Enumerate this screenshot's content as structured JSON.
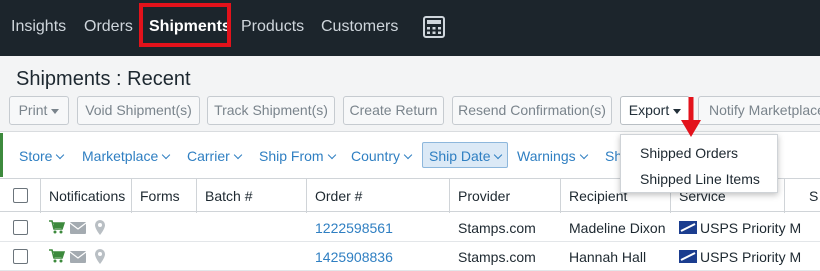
{
  "topnav": {
    "items": [
      {
        "label": "Insights"
      },
      {
        "label": "Orders"
      },
      {
        "label": "Shipments"
      },
      {
        "label": "Products"
      },
      {
        "label": "Customers"
      }
    ],
    "active": "Shipments",
    "icon": "calculator-icon",
    "highlight_color": "#e3121b"
  },
  "header": {
    "title": "Shipments : Recent",
    "buttons": {
      "print": "Print",
      "void": "Void Shipment(s)",
      "track": "Track Shipment(s)",
      "create_return": "Create Return",
      "resend": "Resend Confirmation(s)",
      "export": "Export",
      "notify": "Notify Marketplace"
    }
  },
  "filters": {
    "store": "Store",
    "marketplace": "Marketplace",
    "carrier": "Carrier",
    "ship_from": "Ship From",
    "country": "Country",
    "ship_date": "Ship Date",
    "warnings": "Warnings",
    "truncated": "Sh"
  },
  "export_menu": {
    "items": [
      "Shipped Orders",
      "Shipped Line Items"
    ]
  },
  "grid": {
    "columns": {
      "notifications": "Notifications",
      "forms": "Forms",
      "batch": "Batch #",
      "order": "Order #",
      "provider": "Provider",
      "recipient": "Recipient",
      "service": "Service",
      "last": "S"
    },
    "rows": [
      {
        "order": "1222598561",
        "provider": "Stamps.com",
        "recipient": "Madeline Dixon",
        "service": "USPS Priority M"
      },
      {
        "order": "1425908836",
        "provider": "Stamps.com",
        "recipient": "Hannah Hall",
        "service": "USPS Priority M"
      }
    ]
  },
  "colors": {
    "nav_bg": "#1c252c",
    "link": "#2f7fc2",
    "accent_green": "#3d8a3d",
    "annotation_red": "#e3121b"
  }
}
